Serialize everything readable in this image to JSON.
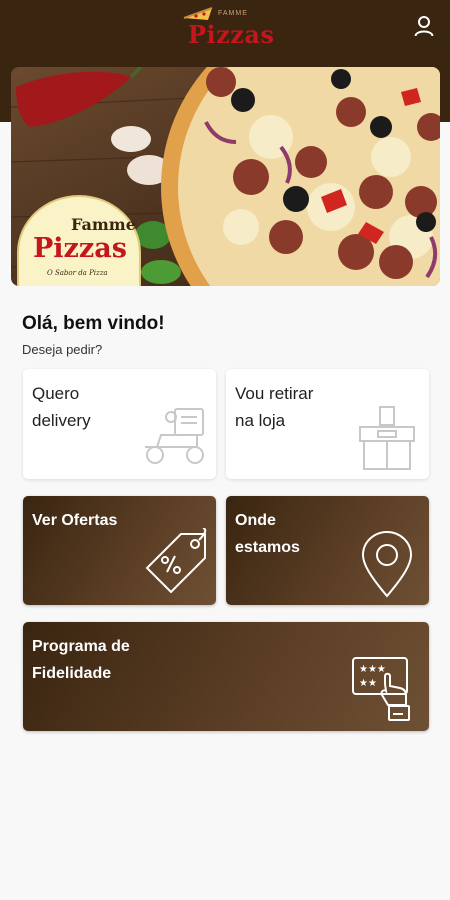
{
  "header": {
    "logo_small": "FAMME",
    "logo_text": "Pizzas",
    "user_icon": "user-icon"
  },
  "banner": {
    "badge_famme": "Famme",
    "badge_pizzas": "Pizzas",
    "badge_slogan": "O Sabor da Pizza"
  },
  "greeting": {
    "title": "Olá, bem vindo!",
    "subtitle": "Deseja pedir?"
  },
  "cards": [
    {
      "label_line1": "Quero",
      "label_line2": "delivery",
      "icon": "delivery-scooter-icon"
    },
    {
      "label_line1": "Vou retirar",
      "label_line2": "na loja",
      "icon": "store-pickup-icon"
    },
    {
      "label_line1": "Ver Ofertas",
      "label_line2": "",
      "icon": "discount-tag-icon"
    },
    {
      "label_line1": "Onde",
      "label_line2": "estamos",
      "icon": "location-pin-icon"
    },
    {
      "label_line1": "Programa de",
      "label_line2": "Fidelidade",
      "icon": "loyalty-card-icon"
    }
  ],
  "colors": {
    "brand_brown": "#3a2510",
    "brand_red": "#c4161c",
    "background": "#f8f8f8"
  }
}
